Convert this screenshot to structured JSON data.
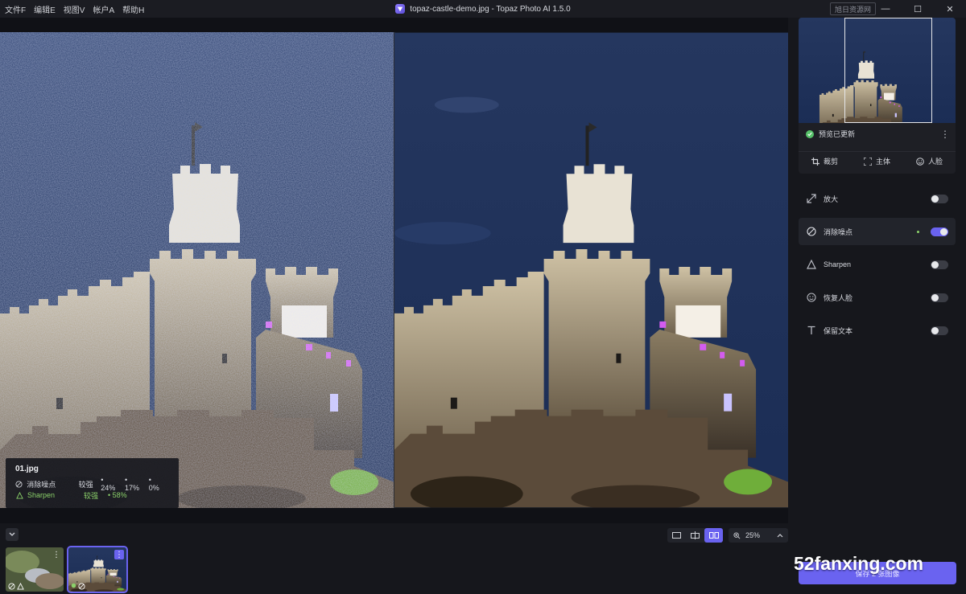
{
  "menu": [
    "文件F",
    "编辑E",
    "视图V",
    "帐户A",
    "帮助H"
  ],
  "window": {
    "title": "topaz-castle-demo.jpg - Topaz Photo AI 1.5.0",
    "watermark_tag": "旭日资源网",
    "minimize": "—",
    "maximize": "☐",
    "close": "✕"
  },
  "info": {
    "filename": "01.jpg",
    "rows": [
      {
        "label": "消除噪点",
        "strength": "较强",
        "values": [
          "• 24%",
          "• 17%",
          "• 0%"
        ]
      },
      {
        "label": "Sharpen",
        "strength": "较强",
        "values": [
          "• 58%"
        ]
      }
    ]
  },
  "zoom": {
    "level": "25%"
  },
  "view_modes": [
    "single-view",
    "split-view",
    "side-by-side-view"
  ],
  "panel": {
    "preview_status": "预览已更新",
    "tools": [
      "裁剪",
      "主体",
      "人脸"
    ],
    "features": [
      {
        "label": "放大",
        "enabled": false
      },
      {
        "label": "消除噪点",
        "enabled": true
      },
      {
        "label": "Sharpen",
        "enabled": false
      },
      {
        "label": "恢复人脸",
        "enabled": false
      },
      {
        "label": "保留文本",
        "enabled": false
      }
    ],
    "save_label": "保存 2 张图像"
  },
  "site_watermark": "52fanxing.com",
  "colors": {
    "accent": "#6a63f0",
    "ok": "#57c26a",
    "highlight": "#8bd16a"
  }
}
